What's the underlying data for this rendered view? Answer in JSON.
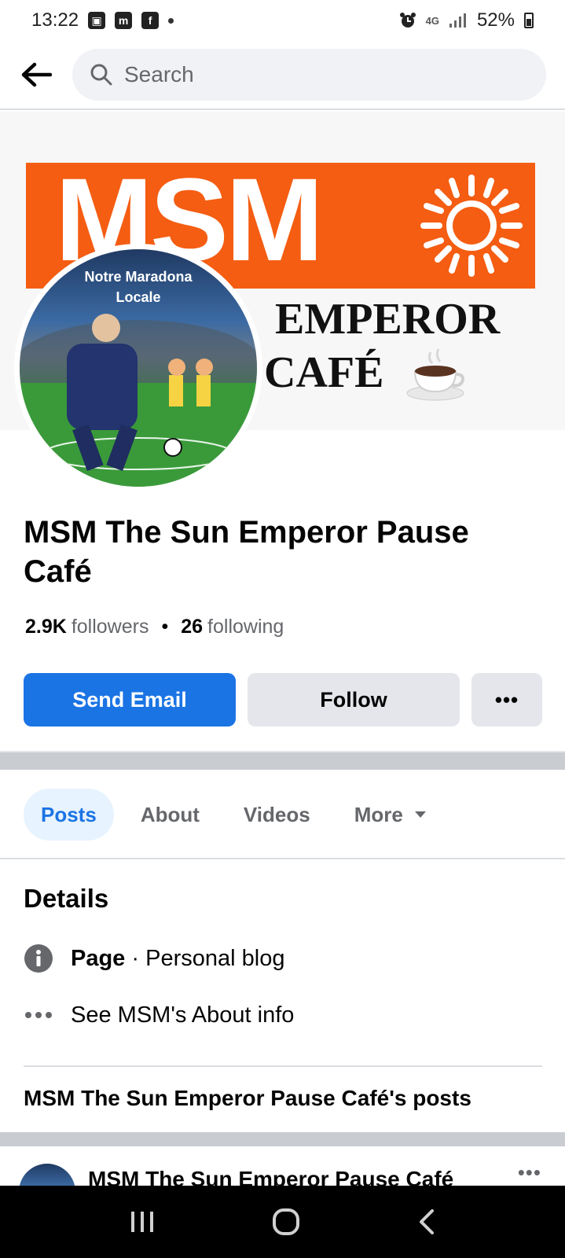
{
  "status_bar": {
    "time": "13:22",
    "network": "4G",
    "battery": "52%",
    "left_icons": [
      "notification-icon",
      "m-app-icon",
      "facebook-icon"
    ],
    "right_icons": [
      "alarm-icon",
      "signal-icon",
      "battery-icon"
    ]
  },
  "header": {
    "search_placeholder": "Search"
  },
  "cover": {
    "brand": "MSM",
    "line1": "EMPEROR",
    "line2": "CAFÉ",
    "accent": "#f45d12"
  },
  "avatar": {
    "caption_line1": "Notre Maradona",
    "caption_line2": "Locale"
  },
  "profile": {
    "title": "MSM The Sun Emperor Pause Café",
    "followers_count": "2.9K",
    "followers_label": "followers",
    "following_count": "26",
    "following_label": "following"
  },
  "actions": {
    "primary_label": "Send Email",
    "secondary_label": "Follow",
    "more_label": "•••",
    "primary_color": "#1b74e4"
  },
  "tabs": [
    {
      "label": "Posts"
    },
    {
      "label": "About"
    },
    {
      "label": "Videos"
    },
    {
      "label": "More"
    }
  ],
  "details": {
    "title": "Details",
    "page_label": "Page",
    "page_sep": " · ",
    "page_category": "Personal blog",
    "about_link": "See MSM's About info"
  },
  "posts": {
    "section_title": "MSM The Sun Emperor Pause Café's posts",
    "first_author": "MSM The Sun Emperor Pause Café",
    "first_more": "•••"
  }
}
